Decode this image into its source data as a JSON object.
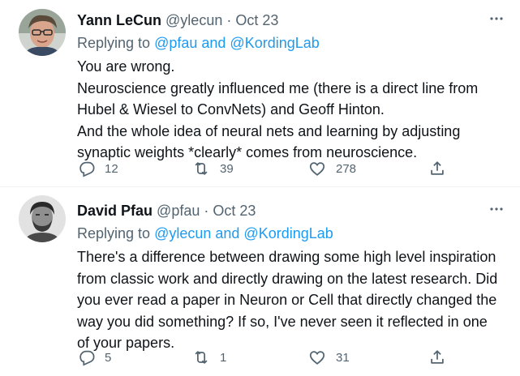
{
  "tweets": [
    {
      "name": "Yann LeCun",
      "handle": "@ylecun",
      "separator": "·",
      "date": "Oct 23",
      "replying_prefix": "Replying to",
      "replying_to": "@pfau and @KordingLab",
      "body_lines": [
        "You are wrong.",
        "Neuroscience greatly influenced me (there is a direct line from",
        "Hubel & Wiesel to ConvNets) and Geoff Hinton.",
        "And the whole idea of neural nets and learning by adjusting",
        "synaptic weights *clearly* comes from neuroscience."
      ],
      "replies": "12",
      "retweets": "39",
      "likes": "278"
    },
    {
      "name": "David Pfau",
      "handle": "@pfau",
      "separator": "·",
      "date": "Oct 23",
      "replying_prefix": "Replying to",
      "replying_to": "@ylecun and @KordingLab",
      "body_lines": [
        "There's a difference between drawing some high level inspiration",
        "from classic work and directly drawing on the latest research. Did",
        "you ever read a paper in Neuron or Cell that directly changed the",
        "way you did something? If so, I've never seen it reflected in one",
        "of your papers."
      ],
      "replies": "5",
      "retweets": "1",
      "likes": "31"
    }
  ],
  "icons": {
    "more": "more-horizontal-icon",
    "reply": "reply-icon",
    "retweet": "retweet-icon",
    "like": "heart-icon",
    "share": "share-icon"
  },
  "colors": {
    "text": "#0f1419",
    "muted": "#536471",
    "link": "#1d9bf0",
    "divider": "#eff3f4"
  }
}
